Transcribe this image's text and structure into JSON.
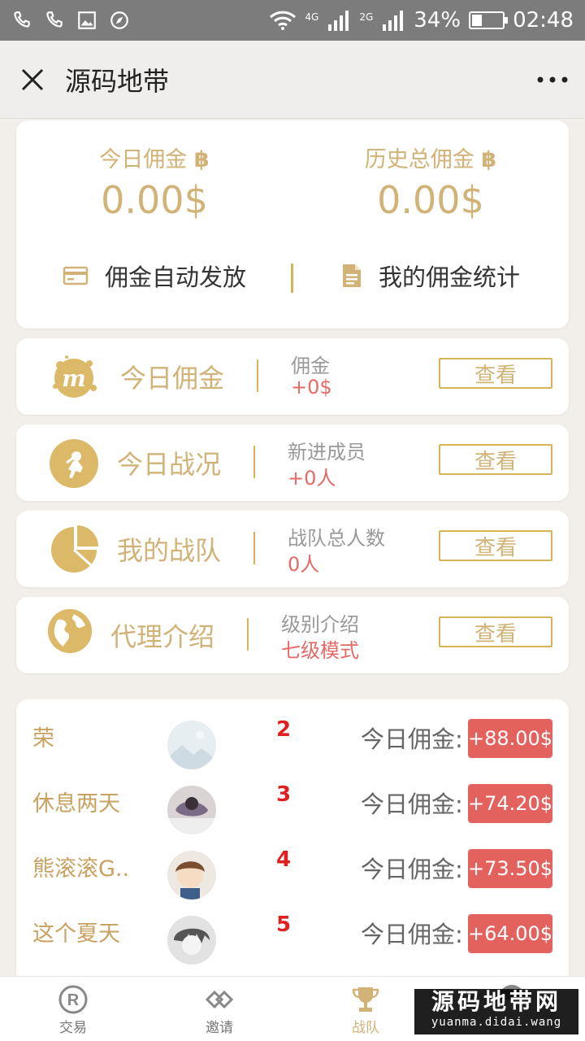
{
  "statusbar": {
    "net1": "4G",
    "net2": "2G",
    "battery": "34%",
    "time": "02:48"
  },
  "titlebar": {
    "title": "源码地带"
  },
  "summary": {
    "today_label": "今日佣金",
    "today_value": "0.00$",
    "total_label": "历史总佣金",
    "total_value": "0.00$",
    "auto_label": "佣金自动发放",
    "stats_label": "我的佣金统计",
    "coin_symbol": "฿"
  },
  "rows": [
    {
      "title": "今日佣金",
      "sub": "佣金",
      "value": "+0$",
      "button": "查看",
      "icon": "m-blob-icon"
    },
    {
      "title": "今日战况",
      "sub": "新进成员",
      "value": "+0人",
      "button": "查看",
      "icon": "astronaut-icon"
    },
    {
      "title": "我的战队",
      "sub": "战队总人数",
      "value": "0人",
      "button": "查看",
      "icon": "pie-chart-icon"
    },
    {
      "title": "代理介绍",
      "sub": "级别介绍",
      "value": "七级模式",
      "button": "查看",
      "icon": "globe-icon"
    }
  ],
  "ranking": [
    {
      "name": "荣",
      "rank": "2",
      "label": "今日佣金:",
      "amount": "+88.00$"
    },
    {
      "name": "休息两天",
      "rank": "3",
      "label": "今日佣金:",
      "amount": "+74.20$"
    },
    {
      "name": "熊滚滚G..",
      "rank": "4",
      "label": "今日佣金:",
      "amount": "+73.50$"
    },
    {
      "name": "这个夏天",
      "rank": "5",
      "label": "今日佣金:",
      "amount": "+64.00$"
    }
  ],
  "nav": [
    {
      "label": "交易",
      "icon": "registered-icon"
    },
    {
      "label": "邀请",
      "icon": "diamond-link-icon"
    },
    {
      "label": "战队",
      "icon": "trophy-icon"
    }
  ],
  "watermark": {
    "big": "源码地带网",
    "small": "yuanma.didai.wang"
  },
  "colors": {
    "gold": "#d1b277",
    "accent_red": "#e4625d",
    "value_red": "#e46a66"
  }
}
